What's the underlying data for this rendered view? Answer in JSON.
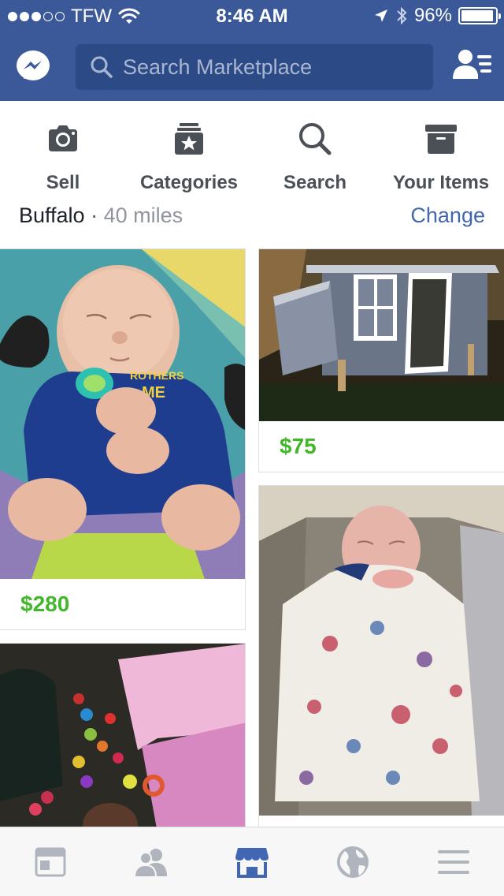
{
  "status_bar": {
    "carrier": "TFW",
    "time": "8:46 AM",
    "battery": "96%",
    "battery_level": 0.96,
    "signal_bars_filled": 3,
    "signal_bars_total": 5
  },
  "header": {
    "search_placeholder": "Search Marketplace"
  },
  "actions": [
    {
      "label": "Sell",
      "icon": "camera-icon"
    },
    {
      "label": "Categories",
      "icon": "categories-icon"
    },
    {
      "label": "Search",
      "icon": "search-icon"
    },
    {
      "label": "Your Items",
      "icon": "box-icon"
    }
  ],
  "location": {
    "city": "Buffalo",
    "separator": "·",
    "distance": "40 miles",
    "change_label": "Change"
  },
  "listings": [
    {
      "price": "$280",
      "photo": "sleeping-baby-blue-onesie"
    },
    {
      "price": "$75",
      "photo": "chicken-coop"
    },
    {
      "price": "",
      "photo": "sleeping-baby-blanket"
    },
    {
      "price": "",
      "photo": "ball-pit-tent"
    }
  ],
  "tabs": [
    {
      "name": "news-feed-icon",
      "active": false
    },
    {
      "name": "friends-icon",
      "active": false
    },
    {
      "name": "marketplace-icon",
      "active": true
    },
    {
      "name": "globe-icon",
      "active": false
    },
    {
      "name": "menu-icon",
      "active": false
    }
  ],
  "colors": {
    "header_bg": "#3b5998",
    "price_green": "#42b72a",
    "link_blue": "#4267b2",
    "active_tab": "#4267b2"
  }
}
